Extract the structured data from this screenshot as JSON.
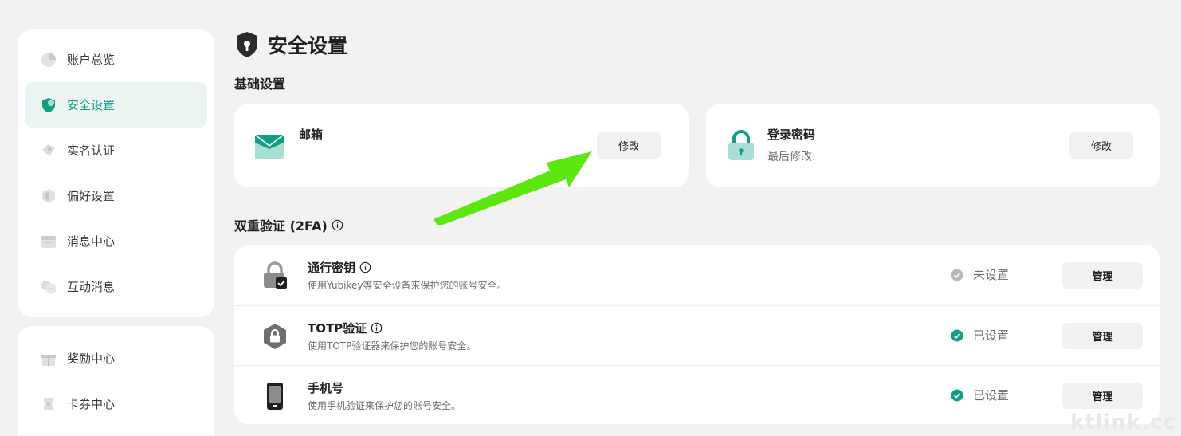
{
  "sidebar": {
    "items": [
      {
        "label": "账户总览",
        "icon": "pie-chart-icon",
        "active": false
      },
      {
        "label": "安全设置",
        "icon": "shield-icon",
        "active": true
      },
      {
        "label": "实名认证",
        "icon": "id-card-icon",
        "active": false
      },
      {
        "label": "偏好设置",
        "icon": "preferences-icon",
        "active": false
      },
      {
        "label": "消息中心",
        "icon": "inbox-icon",
        "active": false
      },
      {
        "label": "互动消息",
        "icon": "chat-bubble-icon",
        "active": false
      }
    ],
    "items2": [
      {
        "label": "奖励中心",
        "icon": "gift-icon"
      },
      {
        "label": "卡券中心",
        "icon": "coupon-icon"
      }
    ]
  },
  "page": {
    "title": "安全设置",
    "title_icon": "shield-lock-icon"
  },
  "basic": {
    "section_title": "基础设置",
    "email": {
      "label": "邮箱",
      "button": "修改",
      "icon": "envelope-icon"
    },
    "password": {
      "label": "登录密码",
      "sub": "最后修改:",
      "button": "修改",
      "icon": "padlock-icon"
    }
  },
  "twofa": {
    "section_title": "双重验证 (2FA)",
    "rows": [
      {
        "name": "通行密钥",
        "desc": "使用Yubikey等安全设备来保护您的账号安全。",
        "status": "未设置",
        "status_set": false,
        "button": "管理",
        "icon": "passkey-lock-icon",
        "has_info": true
      },
      {
        "name": "TOTP验证",
        "desc": "使用TOTP验证器来保护您的账号安全。",
        "status": "已设置",
        "status_set": true,
        "button": "管理",
        "icon": "hexagon-lock-icon",
        "has_info": true
      },
      {
        "name": "手机号",
        "desc": "使用手机验证来保护您的账号安全。",
        "status": "已设置",
        "status_set": true,
        "button": "管理",
        "icon": "phone-icon",
        "has_info": false
      }
    ]
  },
  "watermark": "ktlink.cc",
  "colors": {
    "accent": "#0f9e86",
    "accent_light": "#a9dfd3",
    "annotation_arrow": "#5ce80f",
    "background": "#f2f2f2",
    "status_unset": "#b8b8b8"
  }
}
